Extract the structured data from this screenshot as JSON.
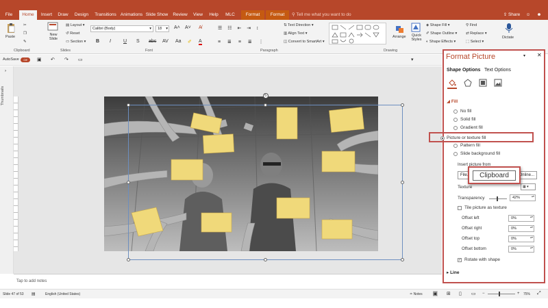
{
  "tabs": [
    {
      "label": "File"
    },
    {
      "label": "Home"
    },
    {
      "label": "Insert"
    },
    {
      "label": "Draw"
    },
    {
      "label": "Design"
    },
    {
      "label": "Transitions"
    },
    {
      "label": "Animations"
    },
    {
      "label": "Slide Show"
    },
    {
      "label": "Review"
    },
    {
      "label": "View"
    },
    {
      "label": "Help"
    },
    {
      "label": "MLC"
    },
    {
      "label": "Format"
    },
    {
      "label": "Format"
    }
  ],
  "tell_me": "Tell me what you want to do",
  "share": "Share",
  "ribbon": {
    "clipboard": {
      "paste": "Paste",
      "label": "Clipboard"
    },
    "slides": {
      "new_slide": "New Slide",
      "layout": "Layout",
      "reset": "Reset",
      "section": "Section",
      "label": "Slides"
    },
    "font": {
      "name": "Calibri (Body)",
      "size": "18",
      "label": "Font"
    },
    "paragraph": {
      "text_direction": "Text Direction",
      "align_text": "Align Text",
      "smartart": "Convert to SmartArt",
      "label": "Paragraph"
    },
    "drawing": {
      "arrange": "Arrange",
      "quick_styles": "Quick Styles",
      "shape_fill": "Shape Fill",
      "shape_outline": "Shape Outline",
      "shape_effects": "Shape Effects",
      "label": "Drawing"
    },
    "editing": {
      "find": "Find",
      "replace": "Replace",
      "select": "Select"
    },
    "voice": {
      "dictate": "Dictate"
    }
  },
  "qat": {
    "autosave": "AutoSave",
    "toggle": "Off"
  },
  "ruler": "| 16 | 15 | 14 | 13 | 12 | 11 | 10 | 9 | 8 | 7 | 6 | 5 | 4 | 3 | 2 | 1 | 0 | 1 | 2 | 3 | 4 | 5 | 6 | 7 | 8 | 9 | 10 | 11 | 12 | 13 | 14 | 15 | 16 |",
  "thumbnails": "Thumbnails",
  "notes_placeholder": "Tap to add notes",
  "status": {
    "slide": "Slide 47 of 53",
    "language": "English (United States)",
    "notes": "Notes",
    "zoom": "75%"
  },
  "panel": {
    "title": "Format Picture",
    "tab_shape": "Shape Options",
    "tab_text": "Text Options",
    "fill_header": "Fill",
    "no_fill": "No fill",
    "solid_fill": "Solid fill",
    "gradient_fill": "Gradient fill",
    "picture_fill": "Picture or texture fill",
    "pattern_fill": "Pattern fill",
    "slide_bg_fill": "Slide background fill",
    "insert_label": "Insert picture from",
    "file_btn": "File...",
    "online_btn": "Online...",
    "clipboard_btn": "Clipboard",
    "texture": "Texture",
    "transparency": "Transparency",
    "transparency_value": "42%",
    "tile": "Tile picture as texture",
    "offset_left": "Offset left",
    "offset_left_v": "0%",
    "offset_right": "Offset right",
    "offset_right_v": "0%",
    "offset_top": "Offset top",
    "offset_top_v": "0%",
    "offset_bottom": "Offset bottom",
    "offset_bottom_v": "0%",
    "rotate": "Rotate with shape",
    "line_header": "Line"
  },
  "colors": {
    "accent": "#b7472a",
    "highlight": "#c0504d",
    "note": "#f0d97a"
  }
}
